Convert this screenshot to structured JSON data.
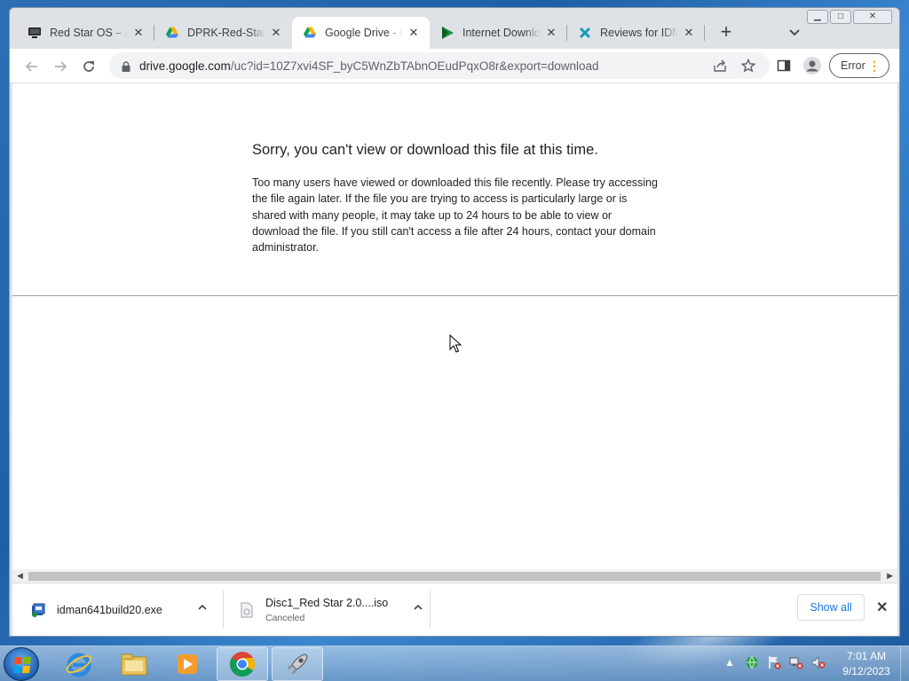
{
  "window": {
    "controls": {
      "minimize": "▁",
      "maximize": "□",
      "close": "✕"
    }
  },
  "tabs": [
    {
      "title": "Red Star OS – An",
      "icon": "monitor-icon"
    },
    {
      "title": "DPRK-Red-Star.is",
      "icon": "google-drive-icon"
    },
    {
      "title": "Google Drive - Q",
      "icon": "google-drive-icon",
      "active": true
    },
    {
      "title": "Internet Downloa",
      "icon": "play-triangle-icon"
    },
    {
      "title": "Reviews for IDM",
      "icon": "puzzle-icon"
    }
  ],
  "toolbar": {
    "url_host": "drive.google.com",
    "url_path": "/uc?id=10Z7xvi4SF_byC5WnZbTAbnOEudPqxO8r&export=download",
    "error_label": "Error"
  },
  "page": {
    "heading": "Sorry, you can't view or download this file at this time.",
    "body": "Too many users have viewed or downloaded this file recently. Please try accessing the file again later. If the file you are trying to access is particularly large or is shared with many people, it may take up to 24 hours to be able to view or download the file. If you still can't access a file after 24 hours, contact your domain administrator."
  },
  "downloads": {
    "items": [
      {
        "name": "idman641build20.exe",
        "status": ""
      },
      {
        "name": "Disc1_Red Star 2.0....iso",
        "status": "Canceled"
      }
    ],
    "show_all": "Show all"
  },
  "taskbar": {
    "time": "7:01 AM",
    "date": "9/12/2023"
  },
  "colors": {
    "accent": "#1a73e8",
    "error_dots": "#f29900",
    "drive_green": "#0f9d58",
    "drive_yellow": "#f4b400",
    "drive_blue": "#4285f4"
  }
}
